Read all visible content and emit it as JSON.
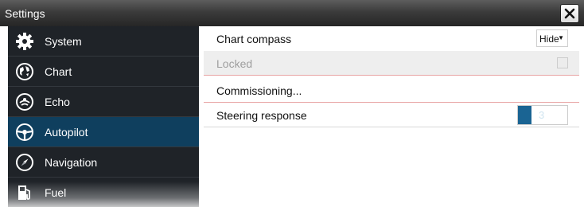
{
  "window": {
    "title": "Settings"
  },
  "titlebar": {
    "close_icon": "close-icon"
  },
  "sidebar": {
    "items": [
      {
        "label": "System",
        "icon": "gear-icon",
        "active": false
      },
      {
        "label": "Chart",
        "icon": "chart-globe-icon",
        "active": false
      },
      {
        "label": "Echo",
        "icon": "echo-sonar-icon",
        "active": false
      },
      {
        "label": "Autopilot",
        "icon": "steering-wheel-icon",
        "active": true
      },
      {
        "label": "Navigation",
        "icon": "compass-icon",
        "active": false
      },
      {
        "label": "Fuel",
        "icon": "fuel-pump-icon",
        "active": false
      }
    ]
  },
  "main": {
    "rows": [
      {
        "label": "Chart compass",
        "control": "select",
        "value": "Hide"
      },
      {
        "label": "Locked",
        "control": "checkbox",
        "checked": false,
        "disabled": true
      },
      {
        "label": "Commissioning...",
        "control": "none"
      },
      {
        "label": "Steering response",
        "control": "slider",
        "value": "3",
        "fill_fraction": 0.28
      }
    ]
  },
  "colors": {
    "titlebar": "#3b3b3b",
    "sidebar": "#1f2328",
    "active_item": "#0f3f5e",
    "slider_fill": "#1a6493",
    "row_separator": "#e8a5a5"
  }
}
